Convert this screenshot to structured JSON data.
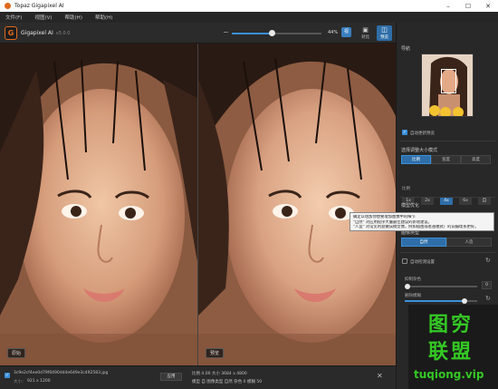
{
  "window": {
    "title": "Topaz Gigapixel AI"
  },
  "menu": [
    "文件(F)",
    "视图(V)",
    "帮助(H)",
    "帮助(H)"
  ],
  "toolbar": {
    "brand": "Gigapixel AI",
    "version": "v5.0.0",
    "zoom_percent": 0.44,
    "zoom_label": "44%",
    "zoom_button": "视",
    "buttons": [
      {
        "label": "对比",
        "icon": "split-view-icon",
        "active": false
      },
      {
        "label": "预览",
        "icon": "preview-icon",
        "active": true
      }
    ]
  },
  "viewer": {
    "left_label": "原始",
    "right_label": "预览"
  },
  "panel": {
    "navigator_title": "导航",
    "auto_update_label": "自动更新预览",
    "scale_mode_title": "选择调整大小模式",
    "scale_modes": [
      {
        "label": "比例",
        "active": true
      },
      {
        "label": "宽度",
        "active": false
      },
      {
        "label": "高度",
        "active": false
      }
    ],
    "scale_buttons": [
      {
        "label": "1x",
        "active": false
      },
      {
        "label": "2x",
        "active": false
      },
      {
        "label": "4x",
        "active": true
      },
      {
        "label": "6x",
        "active": false
      },
      {
        "label": "自",
        "active": false
      }
    ],
    "scale_sub": "比例",
    "model_title": "模型优化",
    "tooltip": [
      "确定以增加你想要增加图像中的细节",
      "\"自然\" 对应用程序大量最佳建议的新增建议。",
      "\"人造\" 对常见利益做成模型像，例如插图或者画模式）的前摄理系更好。"
    ],
    "type_title": "图像类型",
    "type_modes": [
      {
        "label": "自然",
        "active": true
      },
      {
        "label": "人造",
        "active": false
      }
    ],
    "auto_settings_label": "自动检测设置",
    "noise_label": "抑制杂色",
    "noise_value": "0",
    "noise_level": 0.04,
    "blur_label": "删除模糊",
    "blur_level": 0.82
  },
  "status": {
    "file_name": "3c9e2cf4ee0d79f0490dd4e649e3c492583.jpg",
    "size_label": "大小：",
    "size_value": "921 x 1200",
    "apply_label": "应用",
    "scale_info": "比例 4.00  大小 3684 x 4800",
    "mode_info": "模型 自  图像类型 自然  杂色 0  模糊 50"
  },
  "watermark": {
    "line1": "图穷",
    "line2": "联盟",
    "url": "tuqiong.vip"
  },
  "colors": {
    "accent": "#3a8fd9",
    "accent_dark": "#2f6ea8",
    "brand_orange": "#e06a1f",
    "watermark_green": "#34c924"
  }
}
